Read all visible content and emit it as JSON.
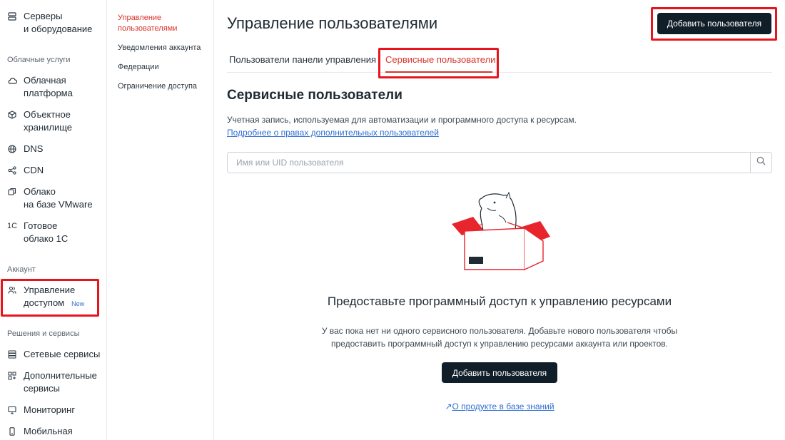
{
  "sidebar": {
    "servers": {
      "line1": "Серверы",
      "line2": "и оборудование"
    },
    "section_cloud": "Облачные услуги",
    "cloud_platform": {
      "line1": "Облачная",
      "line2": "платформа"
    },
    "object_storage": {
      "line1": "Объектное",
      "line2": "хранилище"
    },
    "dns": "DNS",
    "cdn": "CDN",
    "vmware": {
      "line1": "Облако",
      "line2": "на базе VMware"
    },
    "onec": {
      "icon_text": "1С",
      "line1": "Готовое",
      "line2": "облако 1С"
    },
    "section_account": "Аккаунт",
    "access": {
      "line1": "Управление",
      "line2": "доступом",
      "badge": "New"
    },
    "section_solutions": "Решения и сервисы",
    "network": "Сетевые сервисы",
    "additional": {
      "line1": "Дополнительные",
      "line2": "сервисы"
    },
    "monitoring": "Мониторинг",
    "mobile": "Мобильная"
  },
  "subnav": {
    "users_mgmt": "Управление пользователями",
    "notifications": "Уведомления аккаунта",
    "federations": "Федерации",
    "restriction": "Ограничение доступа"
  },
  "header": {
    "title": "Управление пользователями",
    "add_button": "Добавить пользователя"
  },
  "tabs": {
    "panel_users": "Пользователи панели управления",
    "service_users": "Сервисные пользователи"
  },
  "content": {
    "section_title": "Сервисные пользователи",
    "description": "Учетная запись, используемая для автоматизации и программного доступа к ресурсам.",
    "doc_link": "Подробнее о правах дополнительных пользователей",
    "search_placeholder": "Имя или UID пользователя"
  },
  "empty_state": {
    "title": "Предоставьте программный доступ к управлению ресурсами",
    "text_line1": "У вас пока нет ни одного сервисного пользователя. Добавьте нового пользователя чтобы",
    "text_line2": "предоставить программный доступ к управлению ресурсами аккаунта или проектов.",
    "button": "Добавить пользователя",
    "kb_link": "О продукте в базе знаний"
  },
  "colors": {
    "accent_red": "#d9342b",
    "highlight_red": "#e8141c",
    "dark_button": "#101e29",
    "link_blue": "#2f6fd1"
  }
}
